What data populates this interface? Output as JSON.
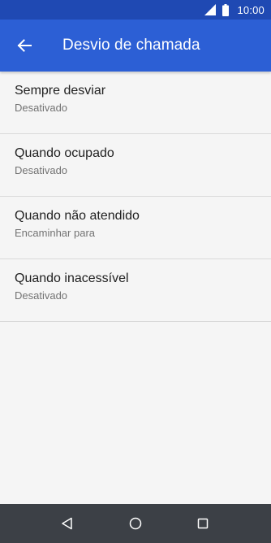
{
  "status_bar": {
    "time": "10:00",
    "signal_icon": "signal-icon",
    "battery_icon": "battery-icon"
  },
  "app_bar": {
    "back_icon": "arrow-back-icon",
    "title": "Desvio de chamada"
  },
  "settings": {
    "items": [
      {
        "title": "Sempre desviar",
        "summary": "Desativado"
      },
      {
        "title": "Quando ocupado",
        "summary": "Desativado"
      },
      {
        "title": "Quando não atendido",
        "summary": "Encaminhar para"
      },
      {
        "title": "Quando inacessível",
        "summary": "Desativado"
      }
    ]
  },
  "nav_bar": {
    "back_icon": "triangle-back-icon",
    "home_icon": "circle-home-icon",
    "recents_icon": "square-recents-icon"
  },
  "colors": {
    "status_bar": "#1f49b3",
    "app_bar": "#2c5fd5",
    "background": "#f5f5f5",
    "nav_bar": "#3c4046",
    "divider": "#d9d9d9",
    "primary_text": "#212121",
    "secondary_text": "#737373"
  }
}
